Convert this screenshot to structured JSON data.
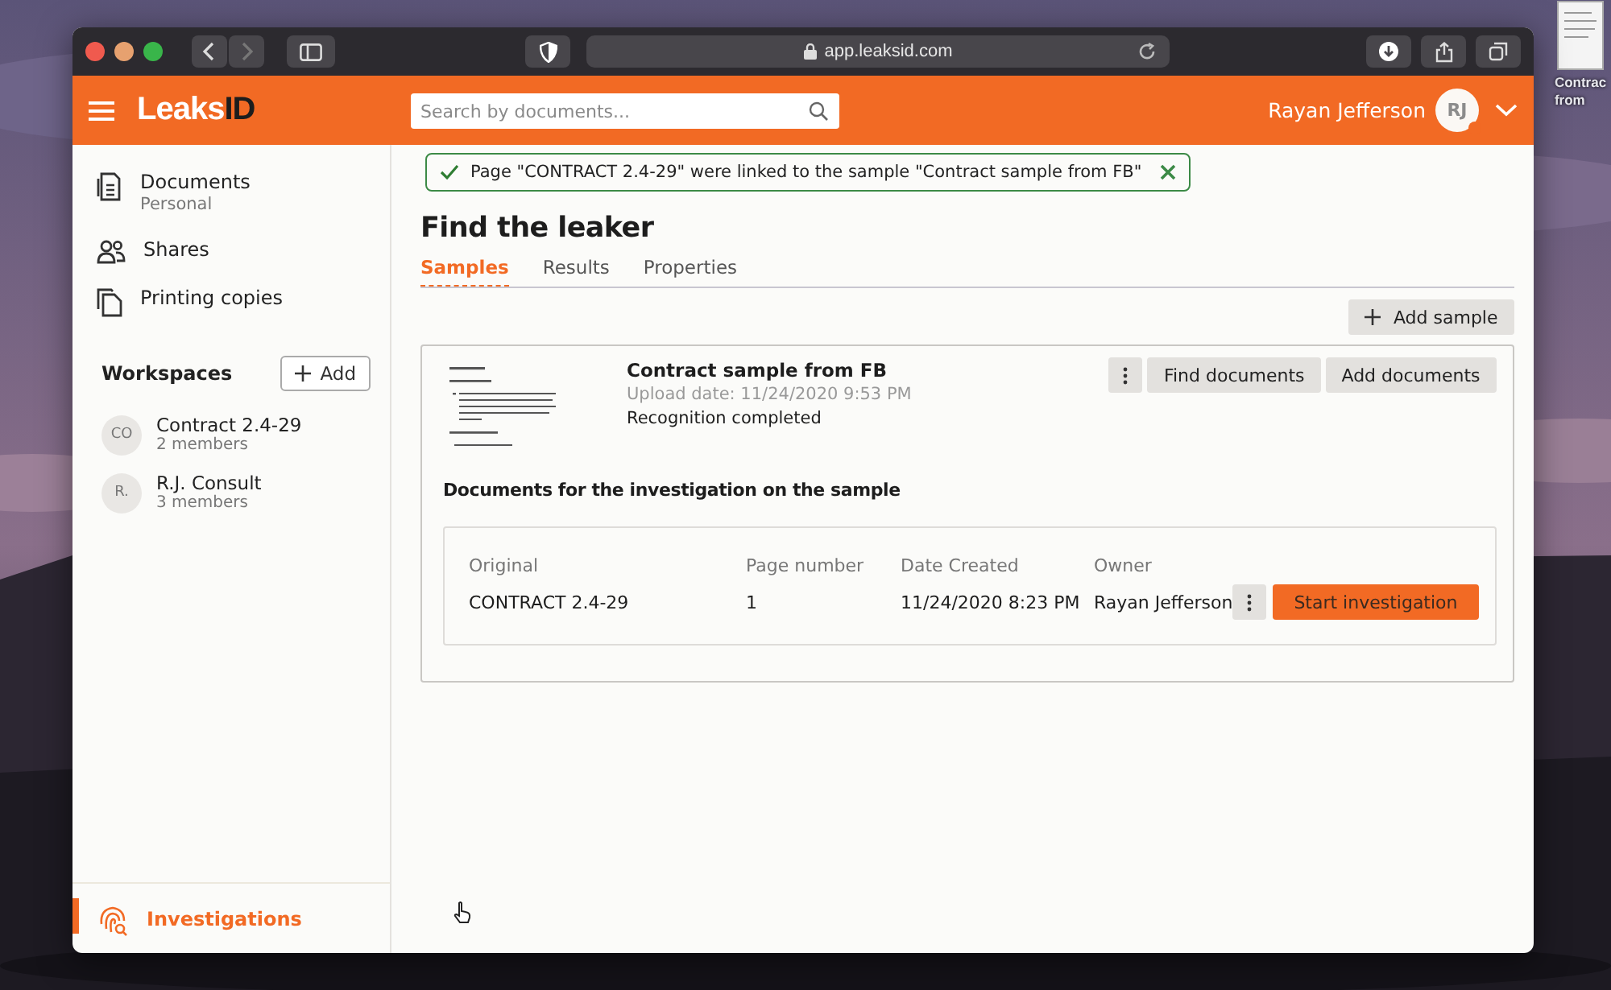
{
  "desktop_file": {
    "label_lines": [
      "Contrac",
      "from"
    ]
  },
  "browser": {
    "url": "app.leaksid.com"
  },
  "app_bar": {
    "logo": {
      "text": "Leaks",
      "accent": "ID"
    },
    "search": {
      "placeholder": "Search by documents..."
    },
    "user": {
      "name": "Rayan Jefferson",
      "initials": "RJ"
    }
  },
  "sidebar": {
    "nav": [
      {
        "label": "Documents",
        "sublabel": "Personal",
        "kind": "documents",
        "selected": false
      },
      {
        "label": "Shares",
        "kind": "shares",
        "selected": false
      },
      {
        "label": "Printing copies",
        "kind": "copies",
        "selected": false
      }
    ],
    "workspaces": {
      "title": "Workspaces",
      "add_button": "Add",
      "items": [
        {
          "initials": "CO",
          "name": "Contract 2.4-29",
          "members": "2 members"
        },
        {
          "initials": "R.",
          "name": "R.J. Consult",
          "members": "3 members"
        }
      ]
    },
    "bottom_nav": [
      {
        "label": "Investigations",
        "kind": "investigations",
        "selected": true
      }
    ]
  },
  "toast": {
    "kind": "success",
    "message": "Page \"CONTRACT 2.4-29\" were linked to the sample \"Contract sample from FB\""
  },
  "page": {
    "title": "Find the leaker",
    "tabs": [
      {
        "label": "Samples",
        "selected": true
      },
      {
        "label": "Results",
        "selected": false
      },
      {
        "label": "Properties",
        "selected": false
      }
    ],
    "add_sample_button": "Add sample",
    "sample": {
      "title": "Contract sample from FB",
      "upload_date": "Upload date: 11/24/2020 9:53 PM",
      "status": "Recognition completed",
      "buttons": [
        "Find documents",
        "Add documents"
      ],
      "section_title": "Documents for the investigation on the sample",
      "documents": {
        "columns": [
          "Original",
          "Page number",
          "Date Created",
          "Owner"
        ],
        "rows": [
          {
            "cells": [
              "CONTRACT 2.4-29",
              "1",
              "11/24/2020 8:23 PM",
              "Rayan Jefferson"
            ],
            "action": "Start investigation"
          }
        ]
      }
    }
  }
}
